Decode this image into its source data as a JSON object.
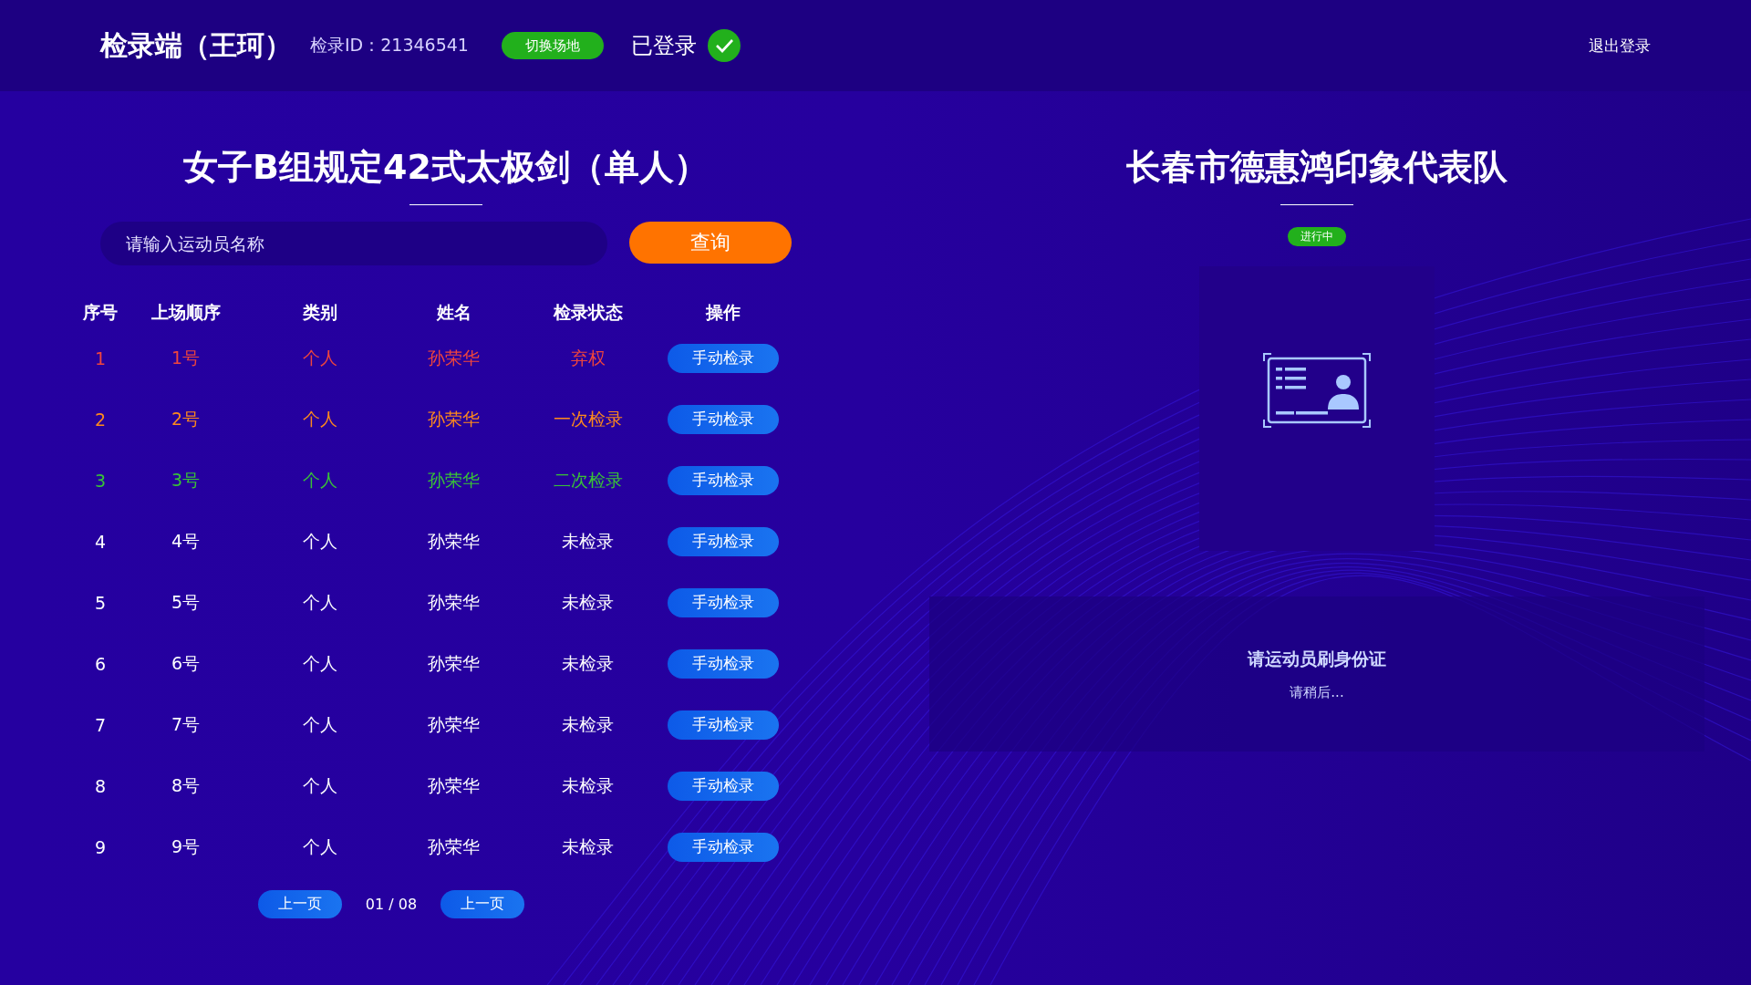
{
  "header": {
    "brand": "检录端（王珂）",
    "checker_id": "检录ID：21346541",
    "switch_button": "切换场地",
    "login_status": "已登录",
    "logged_in": true,
    "logout": "退出登录"
  },
  "left": {
    "title": "女子B组规定42式太极剑（单人）",
    "search": {
      "placeholder": "请输入运动员名称"
    },
    "search_button": "查询",
    "table": {
      "columns": [
        "序号",
        "上场顺序",
        "类别",
        "姓名",
        "检录状态",
        "操作"
      ],
      "rows": [
        {
          "no": "1",
          "order": "1号",
          "category": "个人",
          "name": "孙荣华",
          "status": "弃权",
          "kind": "forfeit",
          "action": "手动检录"
        },
        {
          "no": "2",
          "order": "2号",
          "category": "个人",
          "name": "孙荣华",
          "status": "一次检录",
          "kind": "first",
          "action": "手动检录"
        },
        {
          "no": "3",
          "order": "3号",
          "category": "个人",
          "name": "孙荣华",
          "status": "二次检录",
          "kind": "second",
          "action": "手动检录"
        },
        {
          "no": "4",
          "order": "4号",
          "category": "个人",
          "name": "孙荣华",
          "status": "未检录",
          "kind": "pending",
          "action": "手动检录"
        },
        {
          "no": "5",
          "order": "5号",
          "category": "个人",
          "name": "孙荣华",
          "status": "未检录",
          "kind": "pending",
          "action": "手动检录"
        },
        {
          "no": "6",
          "order": "6号",
          "category": "个人",
          "name": "孙荣华",
          "status": "未检录",
          "kind": "pending",
          "action": "手动检录"
        },
        {
          "no": "7",
          "order": "7号",
          "category": "个人",
          "name": "孙荣华",
          "status": "未检录",
          "kind": "pending",
          "action": "手动检录"
        },
        {
          "no": "8",
          "order": "8号",
          "category": "个人",
          "name": "孙荣华",
          "status": "未检录",
          "kind": "pending",
          "action": "手动检录"
        },
        {
          "no": "9",
          "order": "9号",
          "category": "个人",
          "name": "孙荣华",
          "status": "未检录",
          "kind": "pending",
          "action": "手动检录"
        }
      ]
    },
    "pagination": {
      "prev": "上一页",
      "page": "01 / 08",
      "next": "上一页"
    }
  },
  "right": {
    "team": "长春市德惠鸿印象代表队",
    "status_badge": "进行中",
    "prompt": "请运动员刷身份证",
    "hint": "请稍后..."
  }
}
